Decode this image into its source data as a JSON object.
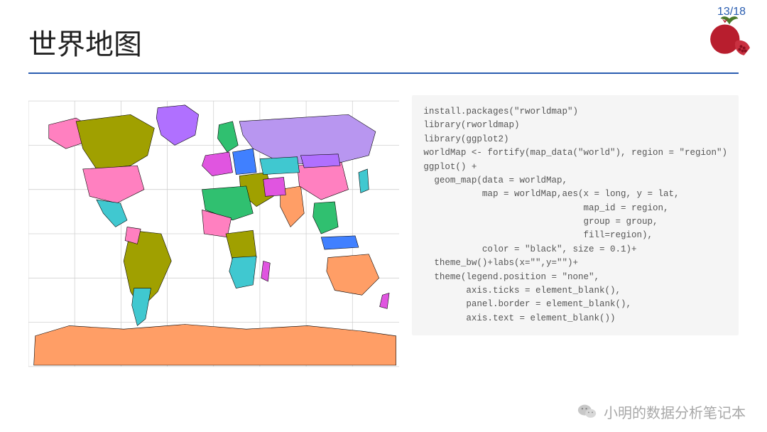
{
  "page": {
    "current": 13,
    "total": 18,
    "display": "13/18"
  },
  "title": "世界地图",
  "footer": {
    "channel": "小明的数据分析笔记本"
  },
  "icons": {
    "logo_name": "pomegranate-icon",
    "wechat_name": "wechat-icon"
  },
  "map": {
    "description": "ggplot2 world map with countries filled by region, black borders, no legend, theme_bw",
    "x_range": [
      -180,
      180
    ],
    "y_range": [
      -90,
      90
    ],
    "grid": true,
    "legend": "none",
    "border_color": "black",
    "border_size": 0.1,
    "fill_by": "region",
    "palette_sample": [
      "#ff80c0",
      "#a0a000",
      "#30c070",
      "#40c8d0",
      "#b070ff",
      "#ff8c40",
      "#4060ff",
      "#e055e0"
    ]
  },
  "code": {
    "lines": [
      "install.packages(\"rworldmap\")",
      "library(rworldmap)",
      "library(ggplot2)",
      "worldMap <- fortify(map_data(\"world\"), region = \"region\")",
      "ggplot() +",
      "  geom_map(data = worldMap,",
      "           map = worldMap,aes(x = long, y = lat,",
      "                              map_id = region,",
      "                              group = group,",
      "                              fill=region),",
      "           color = \"black\", size = 0.1)+",
      "  theme_bw()+labs(x=\"\",y=\"\")+",
      "  theme(legend.position = \"none\",",
      "        axis.ticks = element_blank(),",
      "        panel.border = element_blank(),",
      "        axis.text = element_blank())"
    ]
  }
}
